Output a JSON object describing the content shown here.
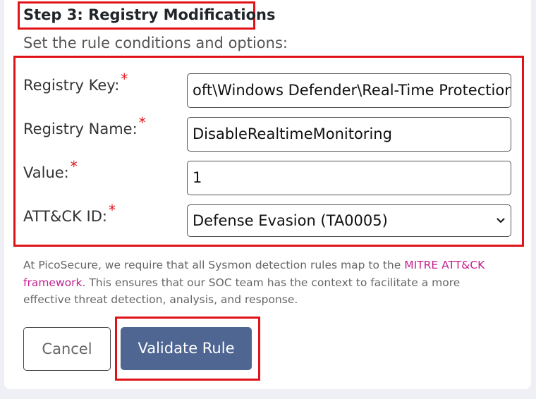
{
  "step": {
    "title": "Step 3: Registry Modifications",
    "subtitle": "Set the rule conditions and options:"
  },
  "fields": {
    "registry_key": {
      "label": "Registry Key:",
      "value": "oft\\Windows Defender\\Real-Time Protection"
    },
    "registry_name": {
      "label": "Registry Name:",
      "value": "DisableRealtimeMonitoring"
    },
    "value": {
      "label": "Value:",
      "value": "1"
    },
    "attck_id": {
      "label": "ATT&CK ID:",
      "selected": "Defense Evasion (TA0005)"
    },
    "required_marker": "*"
  },
  "note": {
    "prefix": "At PicoSecure, we require that all Sysmon detection rules map to the ",
    "link_text": "MITRE ATT&CK framework",
    "suffix": ". This ensures that our SOC team has the context to facilitate a more effective threat detection, analysis, and response."
  },
  "buttons": {
    "cancel": "Cancel",
    "validate": "Validate Rule"
  },
  "colors": {
    "highlight": "#e0131a",
    "primary_button": "#4f6693",
    "link": "#c0208f",
    "required": "#e0131a"
  },
  "icons": {
    "select": "chevron-down-icon"
  }
}
